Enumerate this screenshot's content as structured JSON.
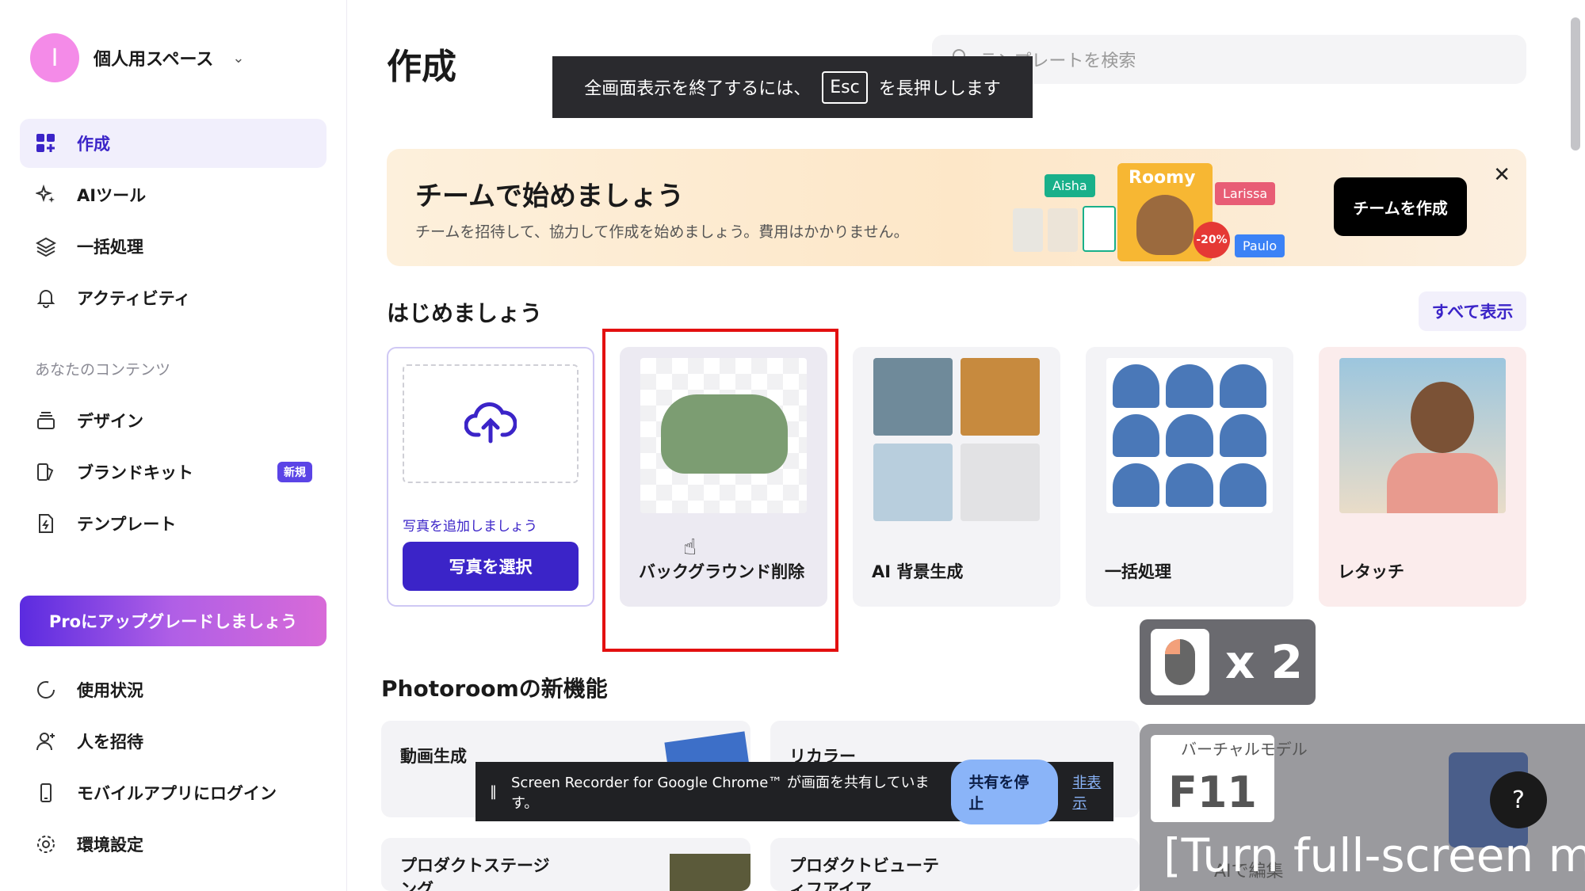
{
  "sidebar": {
    "workspace": {
      "avatar_letter": "I",
      "name": "個人用スペース"
    },
    "nav": [
      {
        "label": "作成"
      },
      {
        "label": "AIツール"
      },
      {
        "label": "一括処理"
      },
      {
        "label": "アクティビティ"
      }
    ],
    "content_section_label": "あなたのコンテンツ",
    "content_nav": [
      {
        "label": "デザイン"
      },
      {
        "label": "ブランドキット",
        "badge": "新規"
      },
      {
        "label": "テンプレート"
      }
    ],
    "upgrade_label": "Proにアップグレードしましょう",
    "bottom_nav": [
      {
        "label": "使用状況"
      },
      {
        "label": "人を招待"
      },
      {
        "label": "モバイルアプリにログイン"
      },
      {
        "label": "環境設定"
      }
    ]
  },
  "main": {
    "title": "作成",
    "search_placeholder": "テンプレートを検索",
    "fullscreen_notice": {
      "before": "全画面表示を終了するには、",
      "key": "Esc",
      "after": "を長押しします"
    },
    "banner": {
      "title": "チームで始めましょう",
      "subtitle": "チームを招待して、協力して作成を始めましょう。費用はかかりません。",
      "button": "チームを作成",
      "tags": [
        "Aisha",
        "Larissa",
        "Paulo"
      ],
      "brand": "Roomy",
      "discount": "-20%"
    },
    "start": {
      "title": "はじめましょう",
      "see_all": "すべて表示",
      "upload_hint": "写真を追加しましょう",
      "upload_button": "写真を選択",
      "cards": [
        "バックグラウンド削除",
        "AI 背景生成",
        "一括処理",
        "レタッチ"
      ]
    },
    "new_features": {
      "title": "Photoroomの新機能",
      "items": [
        "動画生成",
        "リカラー",
        "プロダクトステージング",
        "プロダクトビューティフアイア"
      ]
    }
  },
  "overlays": {
    "share_bar": {
      "text": "Screen Recorder for Google Chrome™ が画面を共有しています。",
      "stop": "共有を停止",
      "hide": "非表示"
    },
    "mouse_count": "x 2",
    "virtual_model_label": "バーチャルモデル",
    "f11_key": "F11",
    "caption": "[Turn full-screen m",
    "ai_edit_label": "AIで編集"
  },
  "colors": {
    "accent": "#3b24c8",
    "highlight": "#e31010",
    "banner_bg": "#fde7c8"
  }
}
